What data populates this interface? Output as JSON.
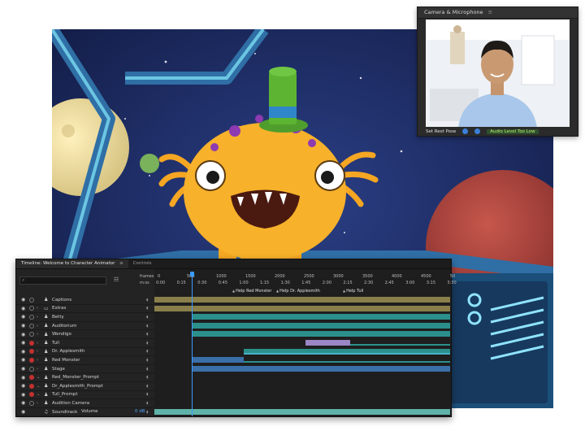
{
  "camera": {
    "title": "Camera & Microphone",
    "rest_pose_label": "Set Rest Pose",
    "audio_level_label": "Audio Level Too Low"
  },
  "timeline": {
    "tab_title": "Timeline: Welcome to Character Animator",
    "tab_controls": "Controls",
    "ruler_frames_label": "frames",
    "ruler_time_label": "m:ss",
    "frame_ticks": [
      "0",
      "500",
      "1000",
      "1500",
      "2000",
      "2500",
      "3000",
      "3500",
      "4000",
      "4500",
      "50"
    ],
    "time_ticks": [
      "0:00",
      "0:15",
      "0:30",
      "0:45",
      "1:00",
      "1:15",
      "1:30",
      "1:45",
      "2:00",
      "2:15",
      "2:30",
      "2:45",
      "3:00",
      "3:15",
      "3:30"
    ],
    "markers": [
      "Help Red Monster",
      "Help Dr. Applesmith",
      "Help Tull"
    ],
    "rows": [
      {
        "name": "Captions",
        "dot": "off",
        "arrow": "",
        "icon": "puppet"
      },
      {
        "name": "Extras",
        "dot": "off",
        "arrow": "›",
        "icon": "folder"
      },
      {
        "name": "Betty",
        "dot": "off",
        "arrow": "›",
        "icon": "puppet"
      },
      {
        "name": "Auditorium",
        "dot": "off",
        "arrow": "›",
        "icon": "puppet"
      },
      {
        "name": "Wendigo",
        "dot": "off",
        "arrow": "›",
        "icon": "puppet"
      },
      {
        "name": "Tull",
        "dot": "red",
        "arrow": "›",
        "icon": "puppet"
      },
      {
        "name": "Dr. Applesmith",
        "dot": "red",
        "arrow": "›",
        "icon": "puppet"
      },
      {
        "name": "Red Monster",
        "dot": "red",
        "arrow": "›",
        "icon": "puppet"
      },
      {
        "name": "Stage",
        "dot": "off",
        "arrow": "›",
        "icon": "puppet"
      },
      {
        "name": "Red_Monster_Prompt",
        "dot": "red",
        "arrow": "⌄",
        "icon": "puppet"
      },
      {
        "name": "Dr_Applesmith_Prompt",
        "dot": "red",
        "arrow": "⌄",
        "icon": "puppet"
      },
      {
        "name": "Tull_Prompt",
        "dot": "red",
        "arrow": "⌄",
        "icon": "puppet"
      },
      {
        "name": "Audition Camera",
        "dot": "off",
        "arrow": "›",
        "icon": "puppet"
      },
      {
        "name": "Soundtrack",
        "dot": "off",
        "arrow": "",
        "icon": "audio"
      }
    ],
    "volume_label": "Volume",
    "volume_value": "0 dB"
  },
  "colors": {
    "accent": "#3b9bff",
    "track_olive": "#8a7f4a",
    "track_teal": "#2b8f8c",
    "track_blue": "#3a6fa8",
    "track_purple": "#9b86c6",
    "audio_wave": "#5fb3a9"
  }
}
